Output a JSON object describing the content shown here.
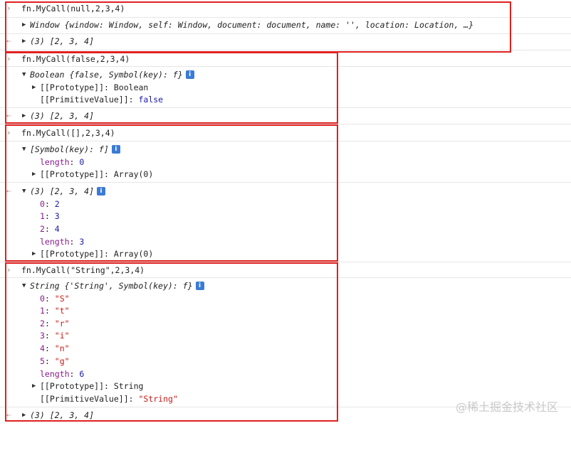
{
  "watermark": "@稀土掘金技术社区",
  "icons": {
    "prompt": "›",
    "result": "⇠",
    "expand": "▶",
    "collapse": "▼",
    "info": "i"
  },
  "blocks": [
    {
      "input": "fn.MyCall(null,2,3,4)",
      "log": {
        "label": "Window",
        "preview": "{window: Window, self: Window, document: document, name: '', location: Location, …}"
      },
      "result": "(3) [2, 3, 4]"
    },
    {
      "input": "fn.MyCall(false,2,3,4)",
      "log": {
        "label": "Boolean",
        "preview": "{false, Symbol(key): f}",
        "rows": [
          {
            "key": "[[Prototype]]",
            "value": "Boolean"
          },
          {
            "key": "[[PrimitiveValue]]",
            "value": "false"
          }
        ]
      },
      "result": "(3) [2, 3, 4]"
    },
    {
      "input": "fn.MyCall([],2,3,4)",
      "log": {
        "preview": "[Symbol(key): f]",
        "rows": [
          {
            "key": "length",
            "value": "0"
          },
          {
            "key": "[[Prototype]]",
            "value": "Array(0)"
          }
        ]
      },
      "result": "(3) [2, 3, 4]",
      "result_rows": [
        {
          "key": "0",
          "value": "2"
        },
        {
          "key": "1",
          "value": "3"
        },
        {
          "key": "2",
          "value": "4"
        },
        {
          "key": "length",
          "value": "3"
        },
        {
          "key": "[[Prototype]]",
          "value": "Array(0)"
        }
      ]
    },
    {
      "input": "fn.MyCall(\"String\",2,3,4)",
      "log": {
        "label": "String",
        "preview": "{'String', Symbol(key): f}",
        "rows": [
          {
            "key": "0",
            "value": "\"S\""
          },
          {
            "key": "1",
            "value": "\"t\""
          },
          {
            "key": "2",
            "value": "\"r\""
          },
          {
            "key": "3",
            "value": "\"i\""
          },
          {
            "key": "4",
            "value": "\"n\""
          },
          {
            "key": "5",
            "value": "\"g\""
          },
          {
            "key": "length",
            "value": "6"
          },
          {
            "key": "[[Prototype]]",
            "value": "String"
          },
          {
            "key": "[[PrimitiveValue]]",
            "value": "\"String\""
          }
        ]
      },
      "result": "(3) [2, 3, 4]"
    }
  ]
}
